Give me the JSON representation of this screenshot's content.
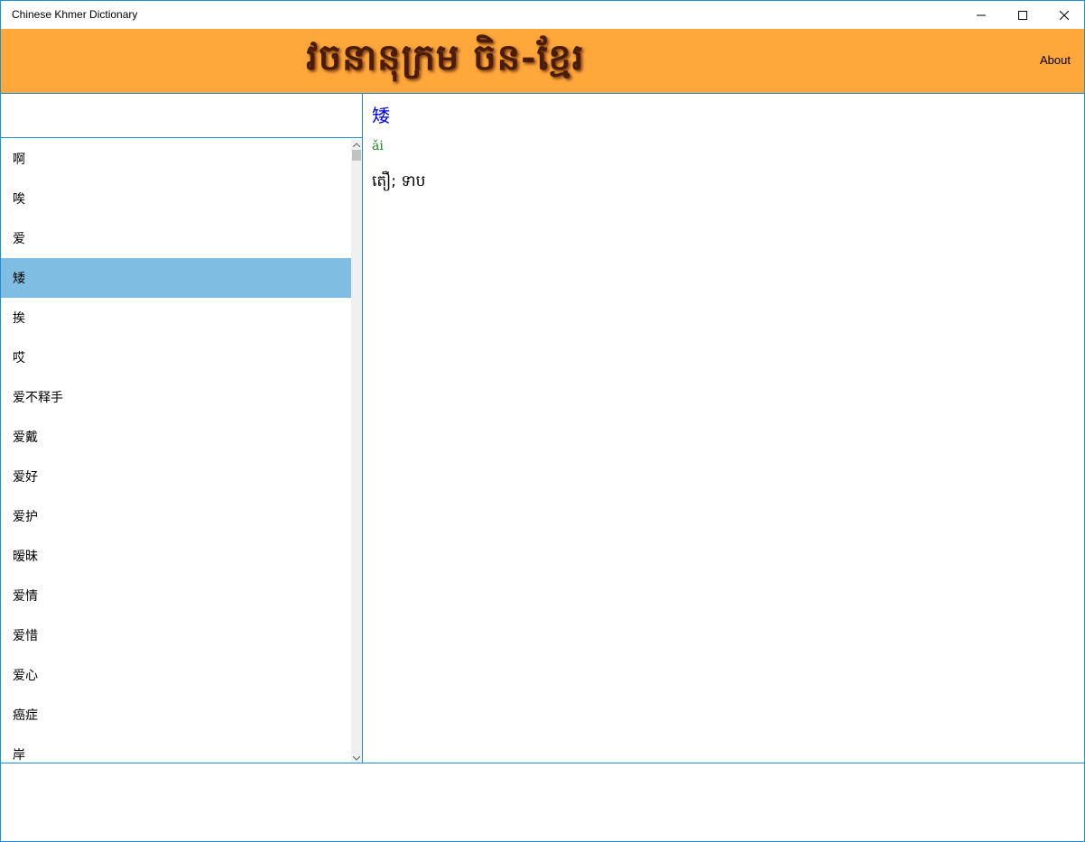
{
  "window": {
    "title": "Chinese Khmer Dictionary"
  },
  "banner": {
    "logo_text": "វចនានុក្រម ចិន-ខ្មែរ",
    "about_label": "About"
  },
  "search": {
    "value": "",
    "placeholder": ""
  },
  "word_list": {
    "items": [
      "啊",
      "唉",
      "爱",
      "矮",
      "挨",
      "哎",
      "爱不释手",
      "爱戴",
      "爱好",
      "爱护",
      "暧昧",
      "爱情",
      "爱惜",
      "爱心",
      "癌症",
      "岸"
    ],
    "selected_index": 3
  },
  "detail": {
    "word": "矮",
    "pinyin": "ǎi",
    "meaning": "តឿ; ទាប"
  },
  "colors": {
    "banner_bg": "#fea73b",
    "selection_bg": "#80bde2",
    "border": "#1e8fd6",
    "word_color": "#0000ff",
    "pinyin_color": "#1a8a1a"
  }
}
